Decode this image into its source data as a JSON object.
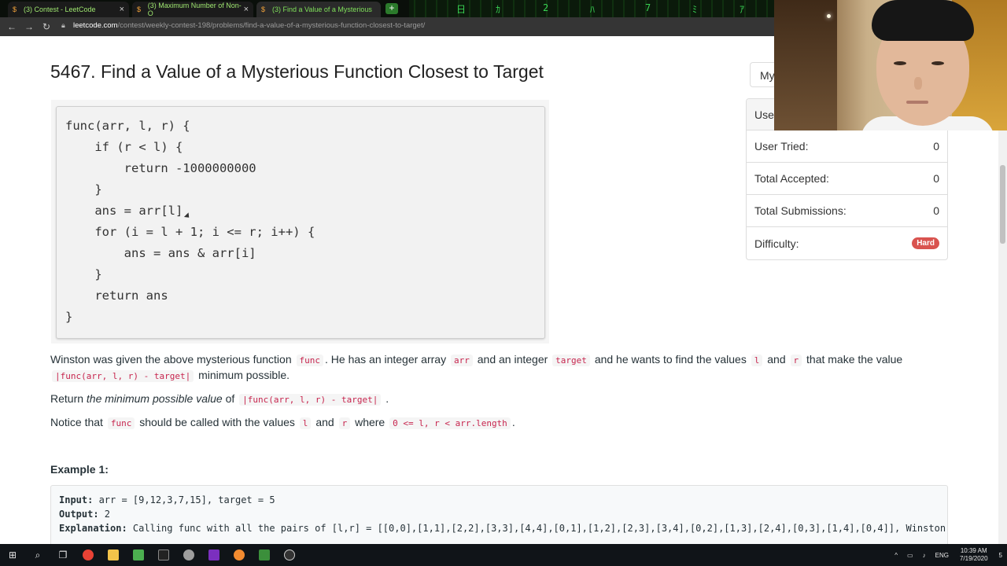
{
  "browser": {
    "tabs": [
      {
        "title": "(3) Contest - LeetCode"
      },
      {
        "title": "(3) Maximum Number of Non-O"
      },
      {
        "title": "(3) Find a Value of a Mysterious"
      }
    ],
    "url_host": "leetcode.com",
    "url_path": "/contest/weekly-contest-198/problems/find-a-value-of-a-mysterious-function-closest-to-target/"
  },
  "problem": {
    "title": "5467. Find a Value of a Mysterious Function Closest to Target",
    "code_lines": [
      "func(arr, l, r) {",
      "    if (r < l) {",
      "        return -1000000000",
      "    }",
      "    ans = arr[l]",
      "    for (i = l + 1; i <= r; i++) {",
      "        ans = ans & arr[i]",
      "    }",
      "    return ans",
      "}"
    ],
    "desc1_a": "Winston was given the above mysterious function",
    "desc1_code1": "func",
    "desc1_b": ". He has an integer array",
    "desc1_code2": "arr",
    "desc1_c": "and an integer",
    "desc1_code3": "target",
    "desc1_d": "and he wants to find the values",
    "desc1_code4": "l",
    "desc1_e": "and",
    "desc1_code5": "r",
    "desc1_f": "that make the value",
    "desc2_code": "|func(arr, l, r) - target|",
    "desc2_b": "minimum possible.",
    "ret_a": "Return",
    "ret_em": "the minimum possible value",
    "ret_b": "of",
    "ret_code": "|func(arr, l, r) - target|",
    "ret_c": ".",
    "notice_a": "Notice that",
    "notice_code1": "func",
    "notice_b": "should be called with the values",
    "notice_code2": "l",
    "notice_c": "and",
    "notice_code3": "r",
    "notice_d": "where",
    "notice_code4": "0 <= l, r < arr.length",
    "notice_e": ".",
    "example_title": "Example 1:",
    "ex_input_label": "Input:",
    "ex_input": " arr = [9,12,3,7,15], target = 5",
    "ex_output_label": "Output:",
    "ex_output": " 2",
    "ex_expl_label": "Explanation:",
    "ex_expl": " Calling func with all the pairs of [l,r] = [[0,0],[1,1],[2,2],[3,3],[4,4],[0,1],[1,2],[2,3],[3,4],[0,2],[1,3],[2,4],[0,3],[1,4],[0,4]], Winston g"
  },
  "side": {
    "my_button": "My",
    "header": "Use",
    "rows": [
      {
        "label": "User Tried:",
        "value": "0"
      },
      {
        "label": "Total Accepted:",
        "value": "0"
      },
      {
        "label": "Total Submissions:",
        "value": "0"
      },
      {
        "label": "Difficulty:",
        "value": "Hard"
      }
    ]
  },
  "taskbar": {
    "lang": "ENG",
    "time": "10:39 AM",
    "date": "7/19/2020",
    "notifications": "5"
  },
  "colors": {
    "code_inline": "#c7254e",
    "hard_badge": "#d9534f"
  }
}
